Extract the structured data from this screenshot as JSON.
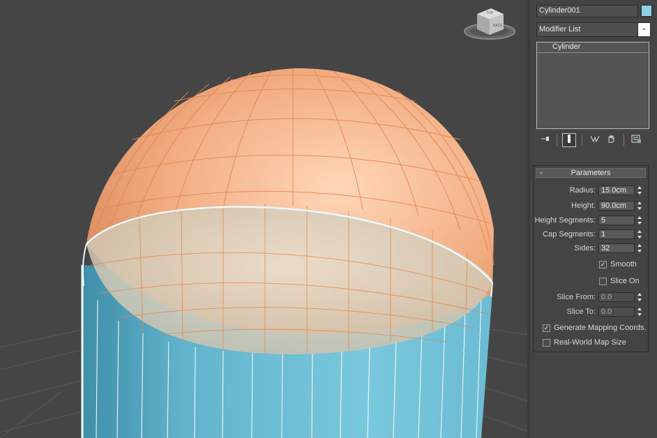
{
  "object": {
    "name": "Cylinder001",
    "color": "#8cd3e6"
  },
  "modifier": {
    "list_label": "Modifier List",
    "dropdown_glyph": "⌄",
    "stack_items": [
      "Cylinder"
    ]
  },
  "stack_toolbar": {
    "icons": [
      "pin-stack-icon",
      "show-end-result-icon",
      "make-unique-icon",
      "remove-modifier-icon",
      "configure-modifier-sets-icon"
    ]
  },
  "parameters": {
    "title": "Parameters",
    "collapse_glyph": "-",
    "radius": {
      "label": "Radius:",
      "value": "15.0cm"
    },
    "height": {
      "label": "Height:",
      "value": "90.0cm"
    },
    "height_segments": {
      "label": "Height Segments:",
      "value": "5"
    },
    "cap_segments": {
      "label": "Cap Segments:",
      "value": "1"
    },
    "sides": {
      "label": "Sides:",
      "value": "32"
    },
    "smooth": {
      "label": "Smooth",
      "checked": true
    },
    "slice_on": {
      "label": "Slice On",
      "checked": false
    },
    "slice_from": {
      "label": "Slice From:",
      "value": "0.0"
    },
    "slice_to": {
      "label": "Slice To:",
      "value": "0.0"
    },
    "generate_mapping": {
      "label": "Generate Mapping Coords.",
      "checked": true
    },
    "real_world_map": {
      "label": "Real-World Map Size",
      "checked": false
    }
  },
  "viewcube": {
    "faces": [
      "BACK",
      "TOP"
    ]
  },
  "colors": {
    "viewport_bg": "#454545",
    "grid": "#5a5a5a",
    "sphere": "#eea57b",
    "sphere_wire": "#e88a57",
    "cylinder": "#6fc0d8",
    "cylinder_wire": "#ffffff",
    "selection_edge": "#dff6ff"
  }
}
